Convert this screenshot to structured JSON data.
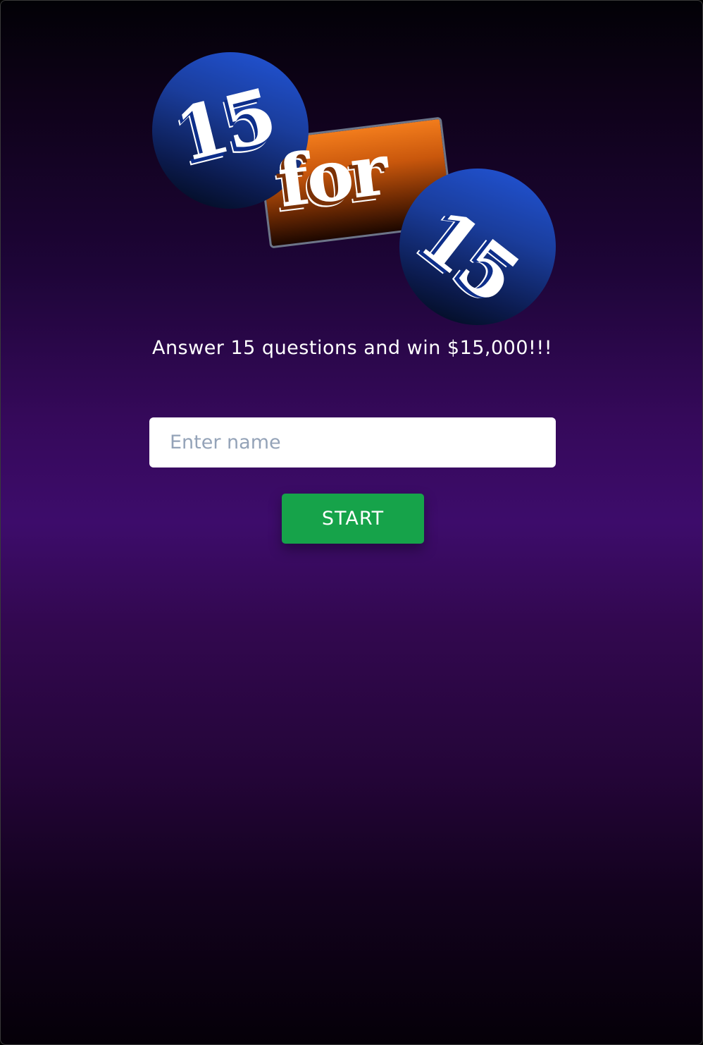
{
  "logo": {
    "number_top": "15",
    "word": "for",
    "number_bottom": "15",
    "colors": {
      "ball": "#1a3d9c",
      "plate": "#f27c1c"
    }
  },
  "tagline": "Answer 15 questions and win $15,000!!!",
  "name_input": {
    "placeholder": "Enter name",
    "value": ""
  },
  "start_button": {
    "label": "START",
    "color": "#16a34a"
  }
}
